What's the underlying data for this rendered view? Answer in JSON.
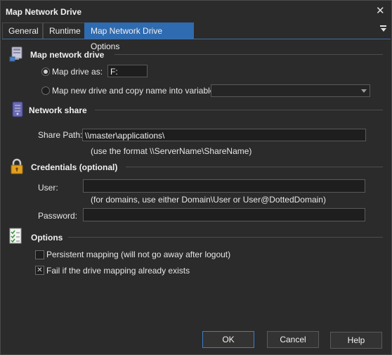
{
  "window": {
    "title": "Map Network Drive",
    "close_glyph": "✕"
  },
  "tabs": [
    {
      "label": "General"
    },
    {
      "label": "Runtime"
    },
    {
      "label": "Map Network Drive Options"
    }
  ],
  "sections": {
    "map_drive": {
      "title": "Map network drive",
      "icon": "network-drive-icon",
      "option_drive_label": "Map drive as:",
      "drive_value": "F:",
      "option_new_label": "Map new drive and copy name into variable:",
      "variable_value": "",
      "selected_option": "map-drive-as"
    },
    "network_share": {
      "title": "Network share",
      "icon": "server-icon",
      "share_path_label": "Share Path:",
      "share_path_value": "\\\\master\\applications\\",
      "share_path_hint": "(use the format \\\\ServerName\\ShareName)"
    },
    "credentials": {
      "title": "Credentials (optional)",
      "icon": "lock-icon",
      "user_label": "User:",
      "user_value": "",
      "user_hint": "(for domains, use either Domain\\User or User@DottedDomain)",
      "password_label": "Password:",
      "password_value": ""
    },
    "options": {
      "title": "Options",
      "icon": "checklist-icon",
      "persistent_label": "Persistent mapping (will not go away after logout)",
      "persistent_checked": false,
      "fail_label": "Fail if the drive mapping already exists",
      "fail_checked": true
    }
  },
  "buttons": {
    "ok": "OK",
    "cancel": "Cancel",
    "help": "Help"
  },
  "colors": {
    "accent": "#2f6bb0",
    "background": "#2b2b2b",
    "input": "#1e1e1e"
  }
}
